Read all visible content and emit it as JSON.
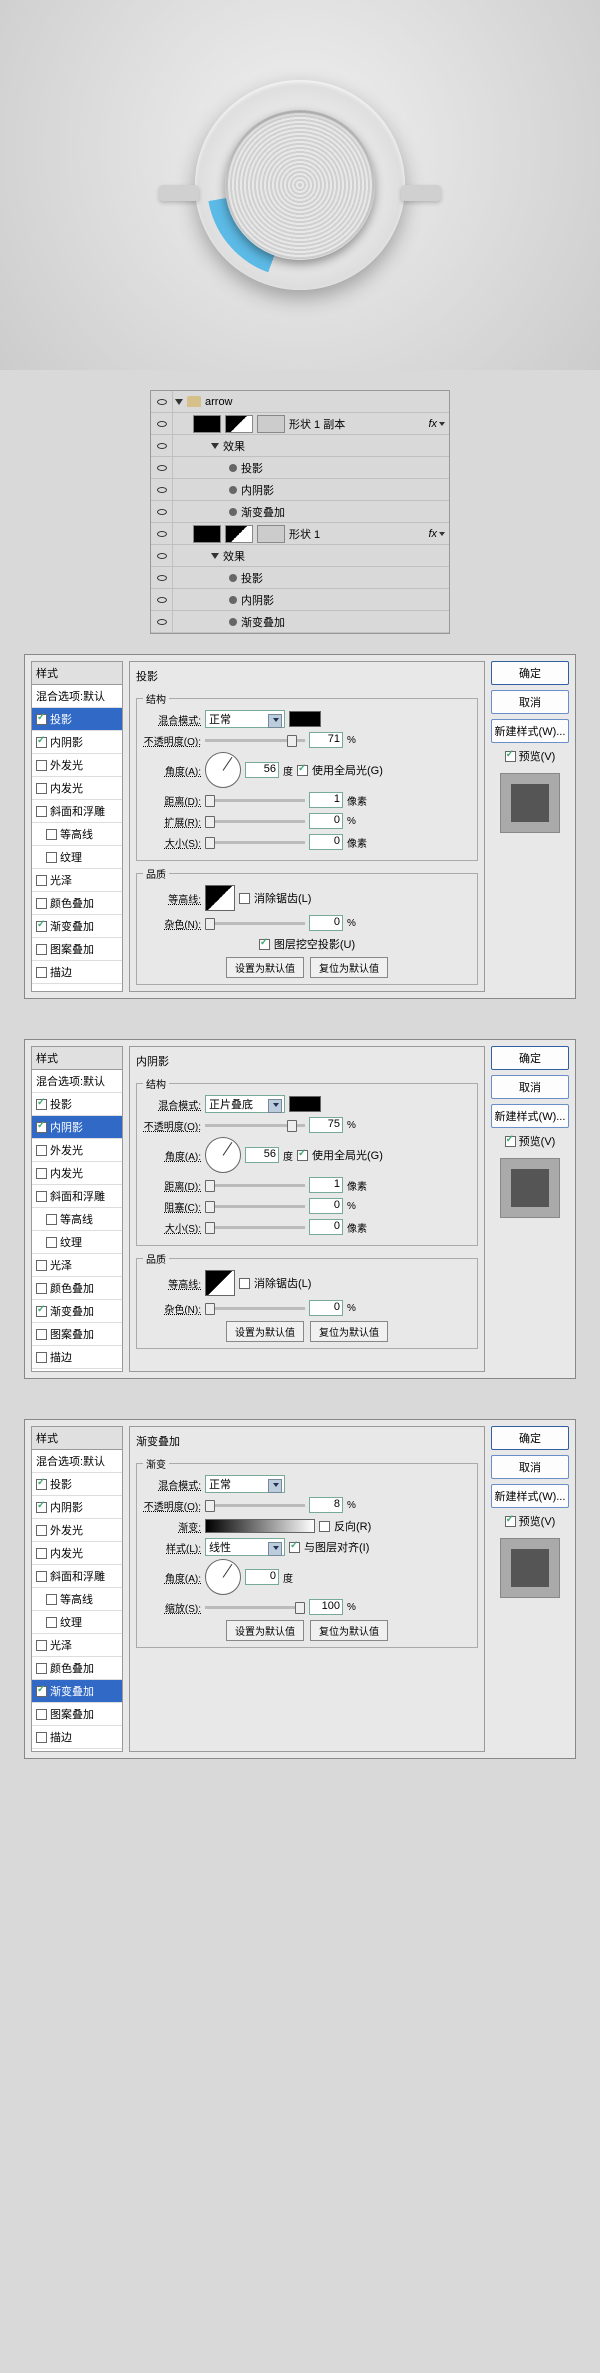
{
  "layers": {
    "group_name": "arrow",
    "shape_copy": "形状 1 副本",
    "shape_1": "形状 1",
    "effects": "效果",
    "drop_shadow": "投影",
    "inner_shadow": "内阴影",
    "gradient_overlay": "渐变叠加",
    "fx": "fx"
  },
  "common": {
    "styles_title": "样式",
    "blend_options": "混合选项:默认",
    "ok": "确定",
    "cancel": "取消",
    "new_style": "新建样式(W)...",
    "preview": "预览(V)",
    "structure": "结构",
    "quality": "品质",
    "gradient_sec": "渐变",
    "blend_mode": "混合模式:",
    "opacity": "不透明度(O):",
    "angle": "角度(A):",
    "degree": "度",
    "use_global": "使用全局光(G)",
    "distance": "距离(D):",
    "spread": "扩展(R):",
    "choke": "阻塞(C):",
    "size": "大小(S):",
    "px": "像素",
    "pct": "%",
    "contour": "等高线:",
    "anti_alias": "消除锯齿(L)",
    "noise": "杂色(N):",
    "knockout": "图层挖空投影(U)",
    "set_default": "设置为默认值",
    "reset_default": "复位为默认值",
    "gradient_label": "渐变:",
    "reverse": "反向(R)",
    "style_label": "样式(L):",
    "linear": "线性",
    "align_layer": "与图层对齐(I)",
    "scale": "缩放(S):",
    "angle_val_56": "56",
    "angle_val_0": "0"
  },
  "styles_list": [
    {
      "key": "drop",
      "label": "投影"
    },
    {
      "key": "inner",
      "label": "内阴影"
    },
    {
      "key": "outer_glow",
      "label": "外发光"
    },
    {
      "key": "inner_glow",
      "label": "内发光"
    },
    {
      "key": "bevel",
      "label": "斜面和浮雕"
    },
    {
      "key": "contour_sub",
      "label": "等高线"
    },
    {
      "key": "texture_sub",
      "label": "纹理"
    },
    {
      "key": "satin",
      "label": "光泽"
    },
    {
      "key": "color_overlay",
      "label": "颜色叠加"
    },
    {
      "key": "grad_overlay",
      "label": "渐变叠加"
    },
    {
      "key": "pattern_overlay",
      "label": "图案叠加"
    },
    {
      "key": "stroke",
      "label": "描边"
    }
  ],
  "dialog1": {
    "title": "投影",
    "blend_name": "正常",
    "opacity": "71",
    "distance": "1",
    "spread": "0",
    "size": "0",
    "noise": "0"
  },
  "dialog2": {
    "title": "内阴影",
    "blend_name": "正片叠底",
    "opacity": "75",
    "distance": "1",
    "choke": "0",
    "size": "0",
    "noise": "0"
  },
  "dialog3": {
    "title": "渐变叠加",
    "blend_name": "正常",
    "opacity": "8",
    "scale": "100"
  }
}
